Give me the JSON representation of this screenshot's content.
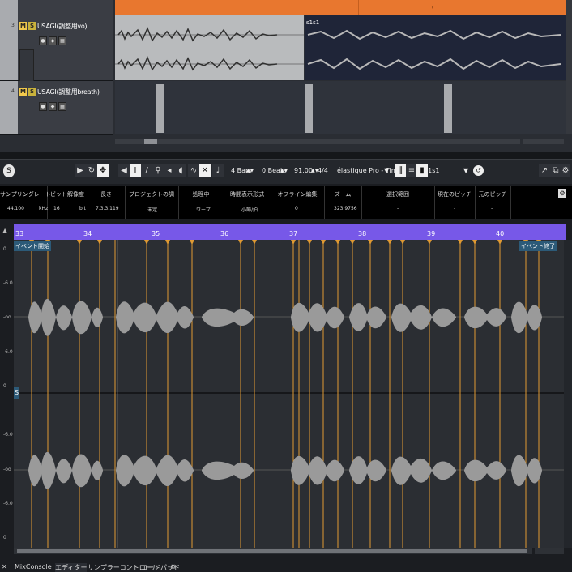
{
  "arrange": {
    "tracks": [
      {
        "number": "3",
        "name": "USAGI(調整用vo)",
        "mute": "M",
        "solo": "S"
      },
      {
        "number": "4",
        "name": "USAGI(調整用breath)",
        "mute": "M",
        "solo": "S"
      }
    ],
    "event_label": "s1s1",
    "inline_marker": "⌐"
  },
  "toolbar": {
    "bars_value": "4 Bars",
    "beats_value": "0 Beats",
    "tempo_value": "91.00",
    "signature": "4/4",
    "algorithm": "élastique Pro - Time",
    "event_name": "s1s1"
  },
  "infobar": {
    "columns": [
      {
        "header": "サンプリングレート",
        "value": "44.100",
        "unit": "kHz"
      },
      {
        "header": "ビット解像度",
        "value": "16",
        "unit": "bit"
      },
      {
        "header": "長さ",
        "value": "7.3.3.119",
        "unit": ""
      },
      {
        "header": "プロジェクトの調",
        "value": "未定",
        "unit": ""
      },
      {
        "header": "処理中",
        "value": "ワープ",
        "unit": ""
      },
      {
        "header": "時間表示形式",
        "value": "小節/拍",
        "unit": ""
      },
      {
        "header": "オフライン編集",
        "value": "0",
        "unit": ""
      },
      {
        "header": "ズーム",
        "value": "323.9756",
        "unit": ""
      },
      {
        "header": "選択範囲",
        "value": "-",
        "unit": ""
      },
      {
        "header": "現在のピッチ",
        "value": "-",
        "unit": ""
      },
      {
        "header": "元のピッチ",
        "value": "-",
        "unit": ""
      }
    ]
  },
  "ruler": {
    "bars": [
      "33",
      "34",
      "35",
      "36",
      "37",
      "38",
      "39",
      "40"
    ],
    "event_start": "イベント開始",
    "event_end": "イベント終了"
  },
  "waveform": {
    "db_labels": [
      "0",
      "-6.0",
      "-oo",
      "-6.0",
      "0",
      "-6.0",
      "-oo",
      "-6.0",
      "0"
    ],
    "handle_label": "S"
  },
  "tabs": {
    "items": [
      "MixConsole",
      "エディター",
      "サンプラーコントロール",
      "コードパッド"
    ]
  },
  "colors": {
    "accent_orange": "#e8772f",
    "ruler_purple": "#7758e8",
    "waveform_gray": "#9a9a9a",
    "warp_marker": "#e09a33"
  }
}
